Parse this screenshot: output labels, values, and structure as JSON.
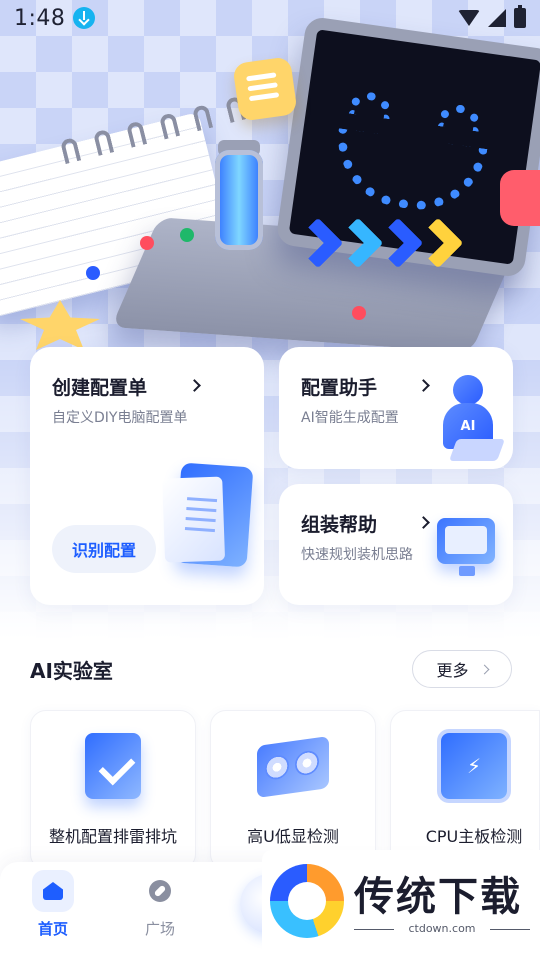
{
  "status_bar": {
    "time": "1:48"
  },
  "cards": {
    "create_config": {
      "title": "创建配置单",
      "subtitle": "自定义DIY电脑配置单",
      "button": "识别配置"
    },
    "config_assistant": {
      "title": "配置助手",
      "subtitle": "AI智能生成配置",
      "badge": "AI"
    },
    "assembly_help": {
      "title": "组装帮助",
      "subtitle": "快速规划装机思路"
    }
  },
  "ai_lab": {
    "title": "AI实验室",
    "more": "更多",
    "items": [
      {
        "label": "整机配置排雷排坑",
        "icon": "pc-case-check-icon"
      },
      {
        "label": "高U低显检测",
        "icon": "graphics-card-icon"
      },
      {
        "label": "CPU主板检测",
        "icon": "cpu-chip-icon"
      }
    ]
  },
  "bottom_nav": {
    "items": [
      {
        "label": "首页",
        "icon": "home-icon",
        "active": true
      },
      {
        "label": "广场",
        "icon": "compass-icon",
        "active": false
      }
    ]
  },
  "watermark": {
    "brand": "传统下载",
    "url": "ctdown.com"
  },
  "colors": {
    "accent": "#1e5eff",
    "background": "#ffffff",
    "card": "#ffffff",
    "muted_text": "#7a7f92"
  }
}
